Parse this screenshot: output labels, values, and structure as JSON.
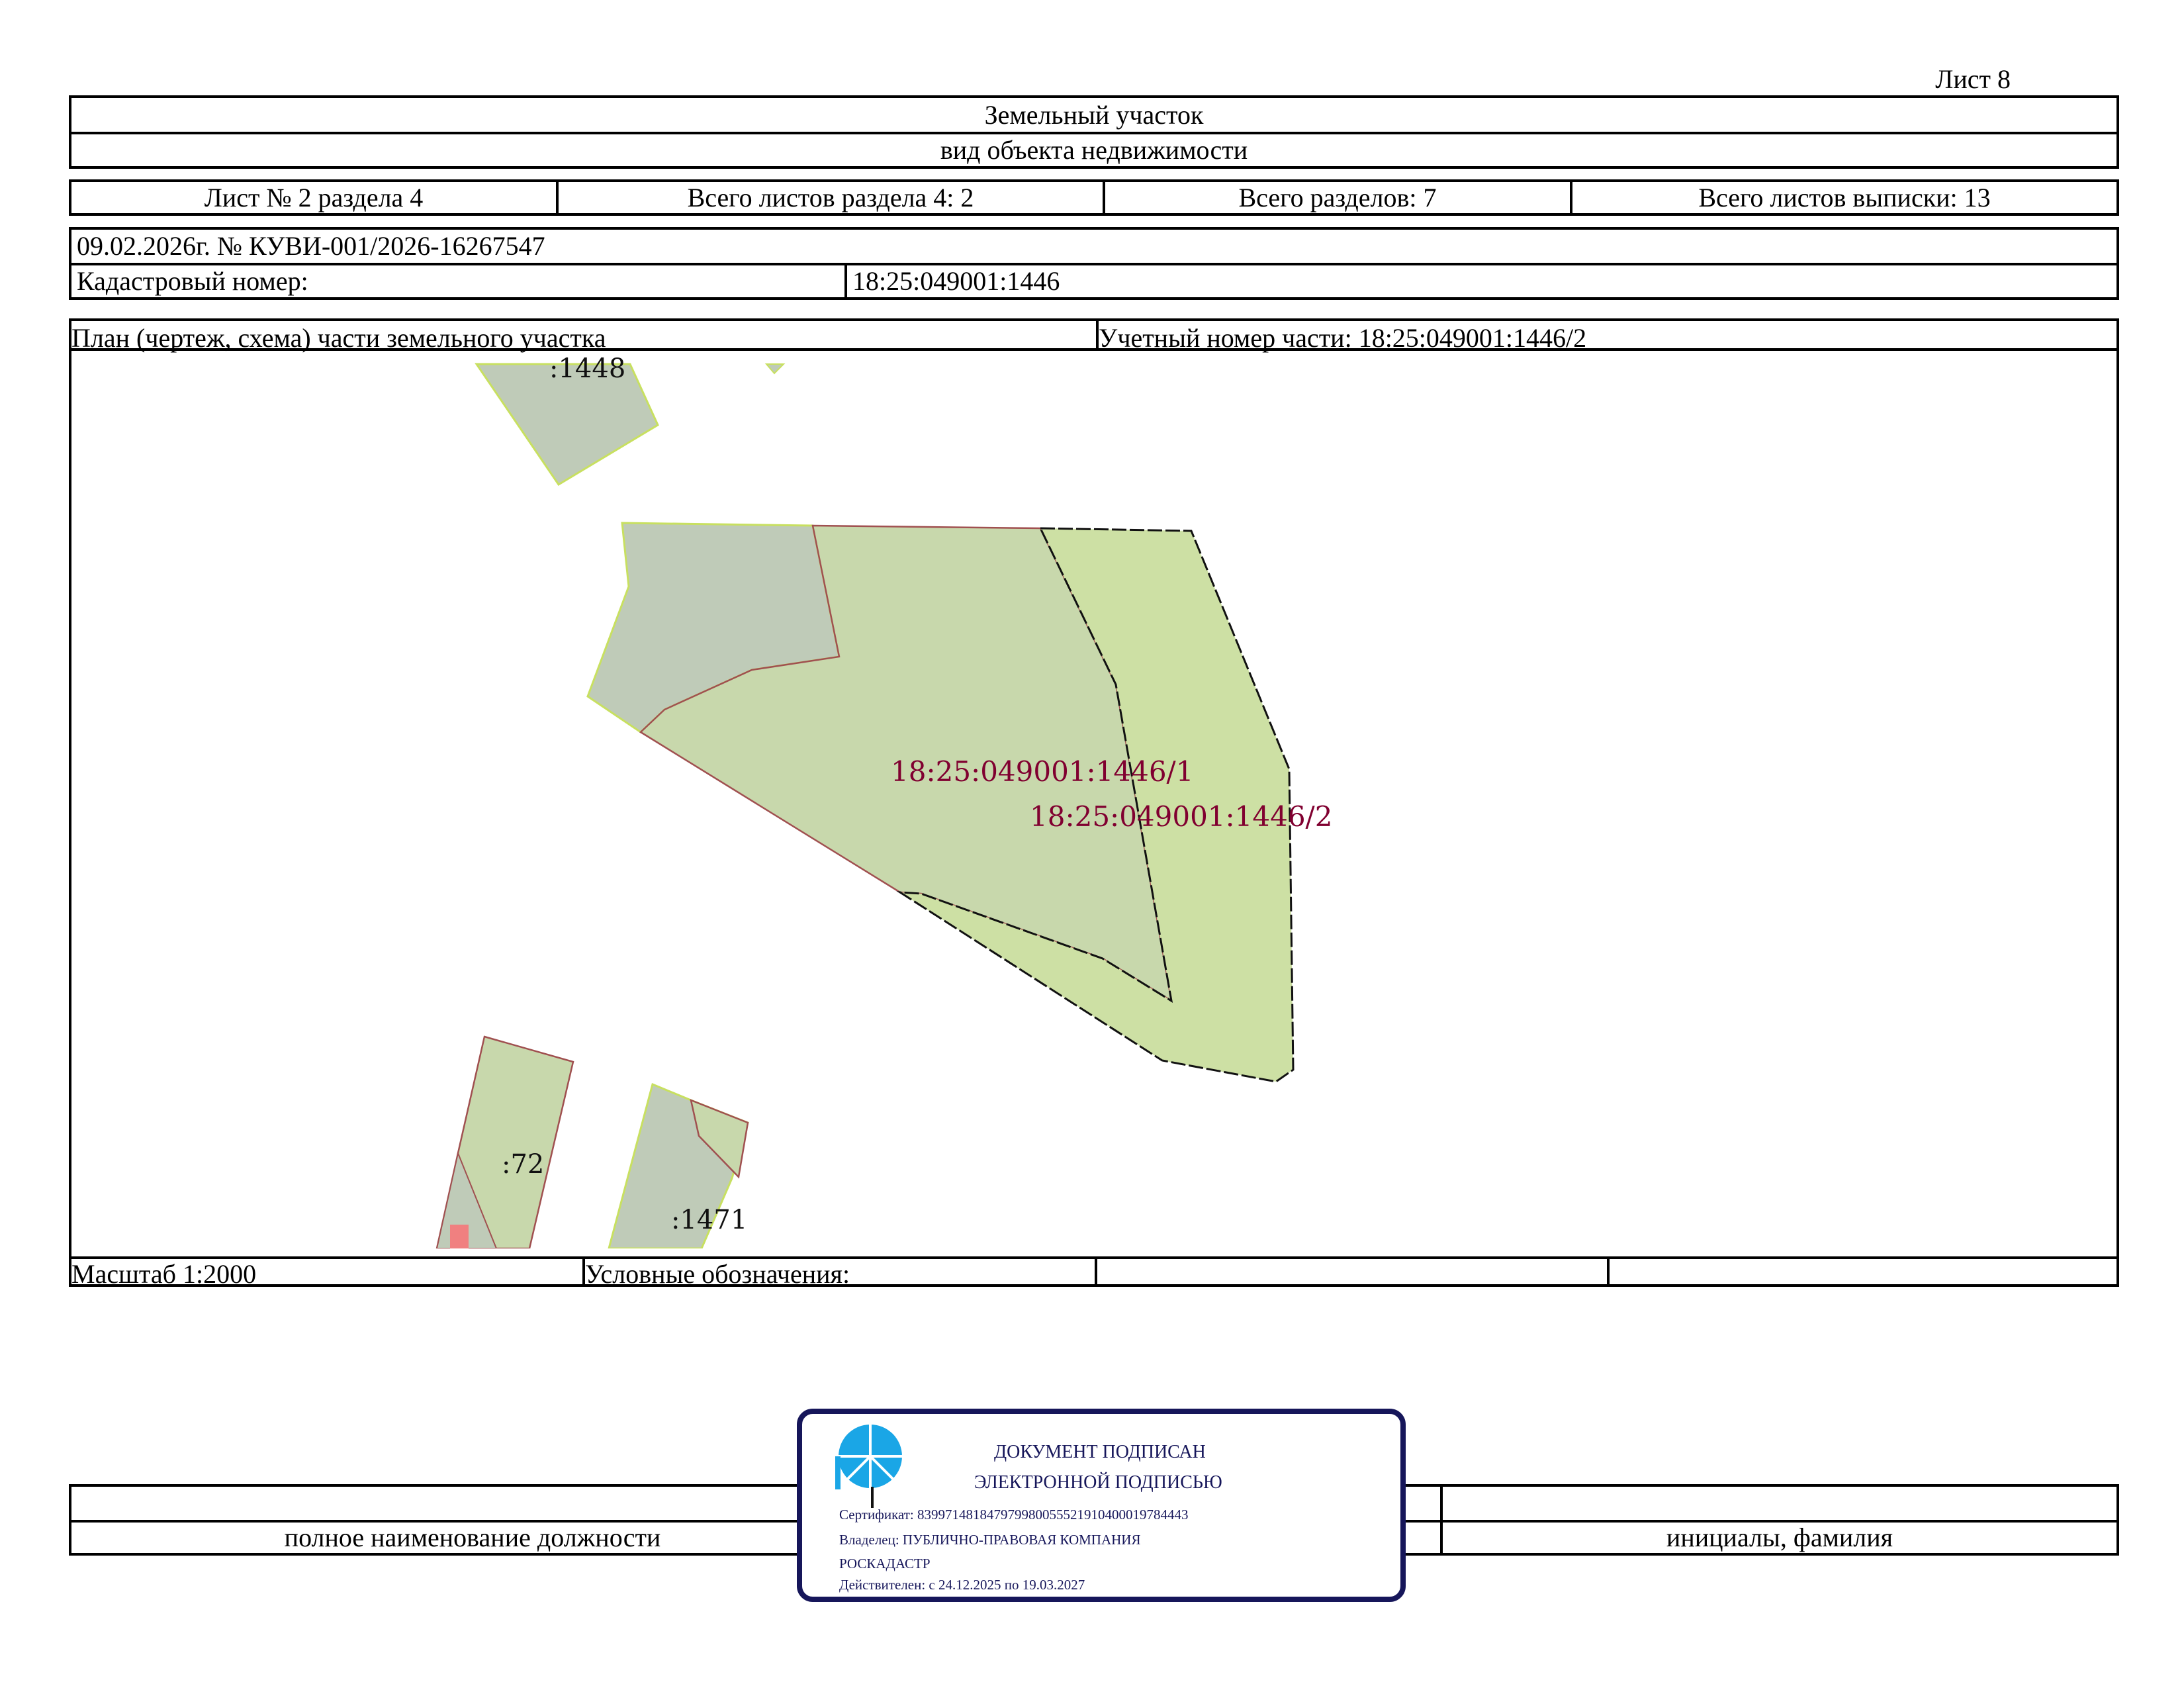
{
  "sheet_label": "Лист 8",
  "header": {
    "object_type": "Земельный участок",
    "object_type_caption": "вид объекта недвижимости"
  },
  "sheet_info": {
    "sheet_of_section": "Лист № 2 раздела 4",
    "total_sheets_section": "Всего листов раздела 4: 2",
    "total_sections": "Всего разделов: 7",
    "total_sheets_extract": "Всего листов выписки: 13"
  },
  "document": {
    "date_number": "09.02.2026г. № КУВИ-001/2026-16267547",
    "cadastral_label": "Кадастровый номер:",
    "cadastral_value": "18:25:049001:1446"
  },
  "plan": {
    "title": "План (чертеж, схема) части земельного участка",
    "part_number": "Учетный номер части: 18:25:049001:1446/2",
    "labels": {
      "part1": "18:25:049001:1446/1",
      "part2": "18:25:049001:1446/2",
      "parcel_1448": ":1448",
      "parcel_72": ":72",
      "parcel_1471": ":1471"
    },
    "colors": {
      "parcel_fill": "#bfcbb8",
      "part1_fill": "#c8d8ac",
      "part2_fill": "#cde0a4",
      "label_color": "#800030",
      "red_mark": "#f08080"
    }
  },
  "footer": {
    "scale": "Масштаб 1:2000",
    "legend": "Условные обозначения:",
    "position_caption": "полное наименование должности",
    "initials_caption": "инициалы, фамилия"
  },
  "stamp": {
    "line1": "ДОКУМЕНТ ПОДПИСАН",
    "line2": "ЭЛЕКТРОННОЙ ПОДПИСЬЮ",
    "certificate": "Сертификат: 839971481847979980055521910400019784443",
    "owner": "Владелец: ПУБЛИЧНО-ПРАВОВАЯ КОМПАНИЯ",
    "owner2": "РОСКАДАСТР",
    "valid": "Действителен: с 24.12.2025 по 19.03.2027",
    "border_color": "#16165a",
    "logo_color": "#1aa6e6"
  }
}
